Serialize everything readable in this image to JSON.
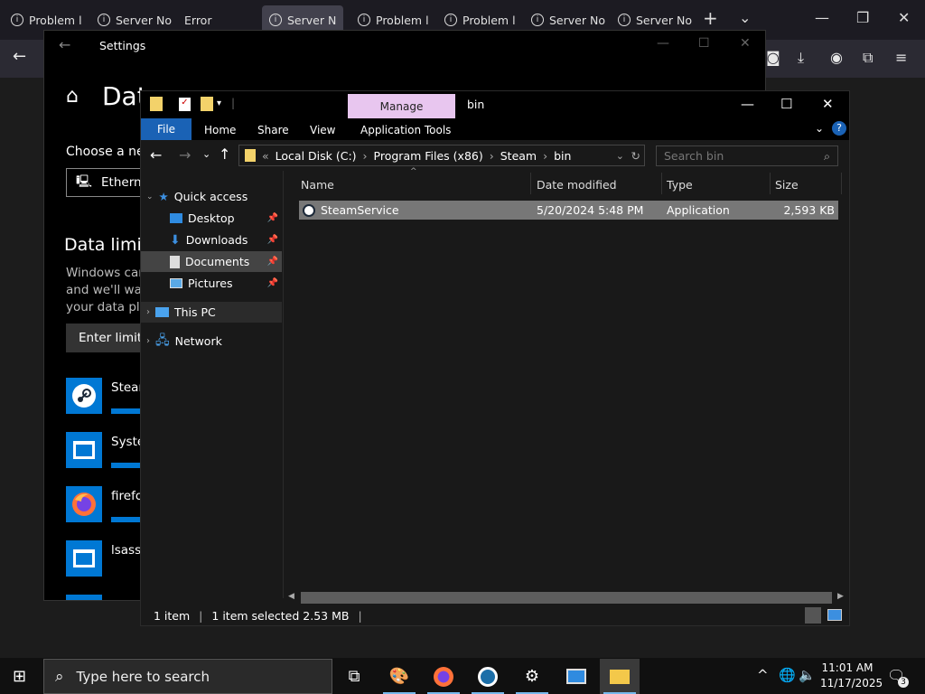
{
  "browser": {
    "tabs": [
      {
        "label": "Problem l"
      },
      {
        "label": "Server No"
      },
      {
        "label": "Error"
      },
      {
        "label": "Server N"
      },
      {
        "label": "Problem l"
      },
      {
        "label": "Problem l"
      },
      {
        "label": "Server No"
      },
      {
        "label": "Server No"
      }
    ],
    "new_tab": "+",
    "list_tabs": "⌄"
  },
  "settings": {
    "title": "Settings",
    "heading": "Dat",
    "choose_label": "Choose a netw",
    "network_value": "Etherne",
    "data_limit_title": "Data limit",
    "desc_lines": [
      "Windows can",
      "and we'll warn",
      "your data pla"
    ],
    "enter_limit": "Enter limit",
    "apps": [
      {
        "name": "Steam"
      },
      {
        "name": "Syster"
      },
      {
        "name": "firefo"
      },
      {
        "name": "lsass"
      }
    ]
  },
  "explorer": {
    "contextual_tab": "Manage",
    "window_title": "bin",
    "ribbon": {
      "file": "File",
      "home": "Home",
      "share": "Share",
      "view": "View",
      "app_tools": "Application Tools"
    },
    "address": {
      "overflow": "«",
      "crumbs": [
        "Local Disk (C:)",
        "Program Files (x86)",
        "Steam",
        "bin"
      ]
    },
    "search_placeholder": "Search bin",
    "nav": {
      "quick_access": "Quick access",
      "pinned": [
        "Desktop",
        "Downloads",
        "Documents",
        "Pictures"
      ],
      "this_pc": "This PC",
      "network": "Network"
    },
    "columns": [
      "Name",
      "Date modified",
      "Type",
      "Size"
    ],
    "files": [
      {
        "name": "SteamService",
        "date": "5/20/2024 5:48 PM",
        "type": "Application",
        "size": "2,593 KB"
      }
    ],
    "status": {
      "count": "1 item",
      "selected": "1 item selected  2.53 MB"
    }
  },
  "taskbar": {
    "search_placeholder": "Type here to search",
    "time": "11:01 AM",
    "date": "11/17/2025",
    "notification_count": "3"
  },
  "colors": {
    "accent": "#0078d4",
    "file_tab": "#1a62b5",
    "manage_tab": "#e8c6ef",
    "selection": "#777777"
  }
}
